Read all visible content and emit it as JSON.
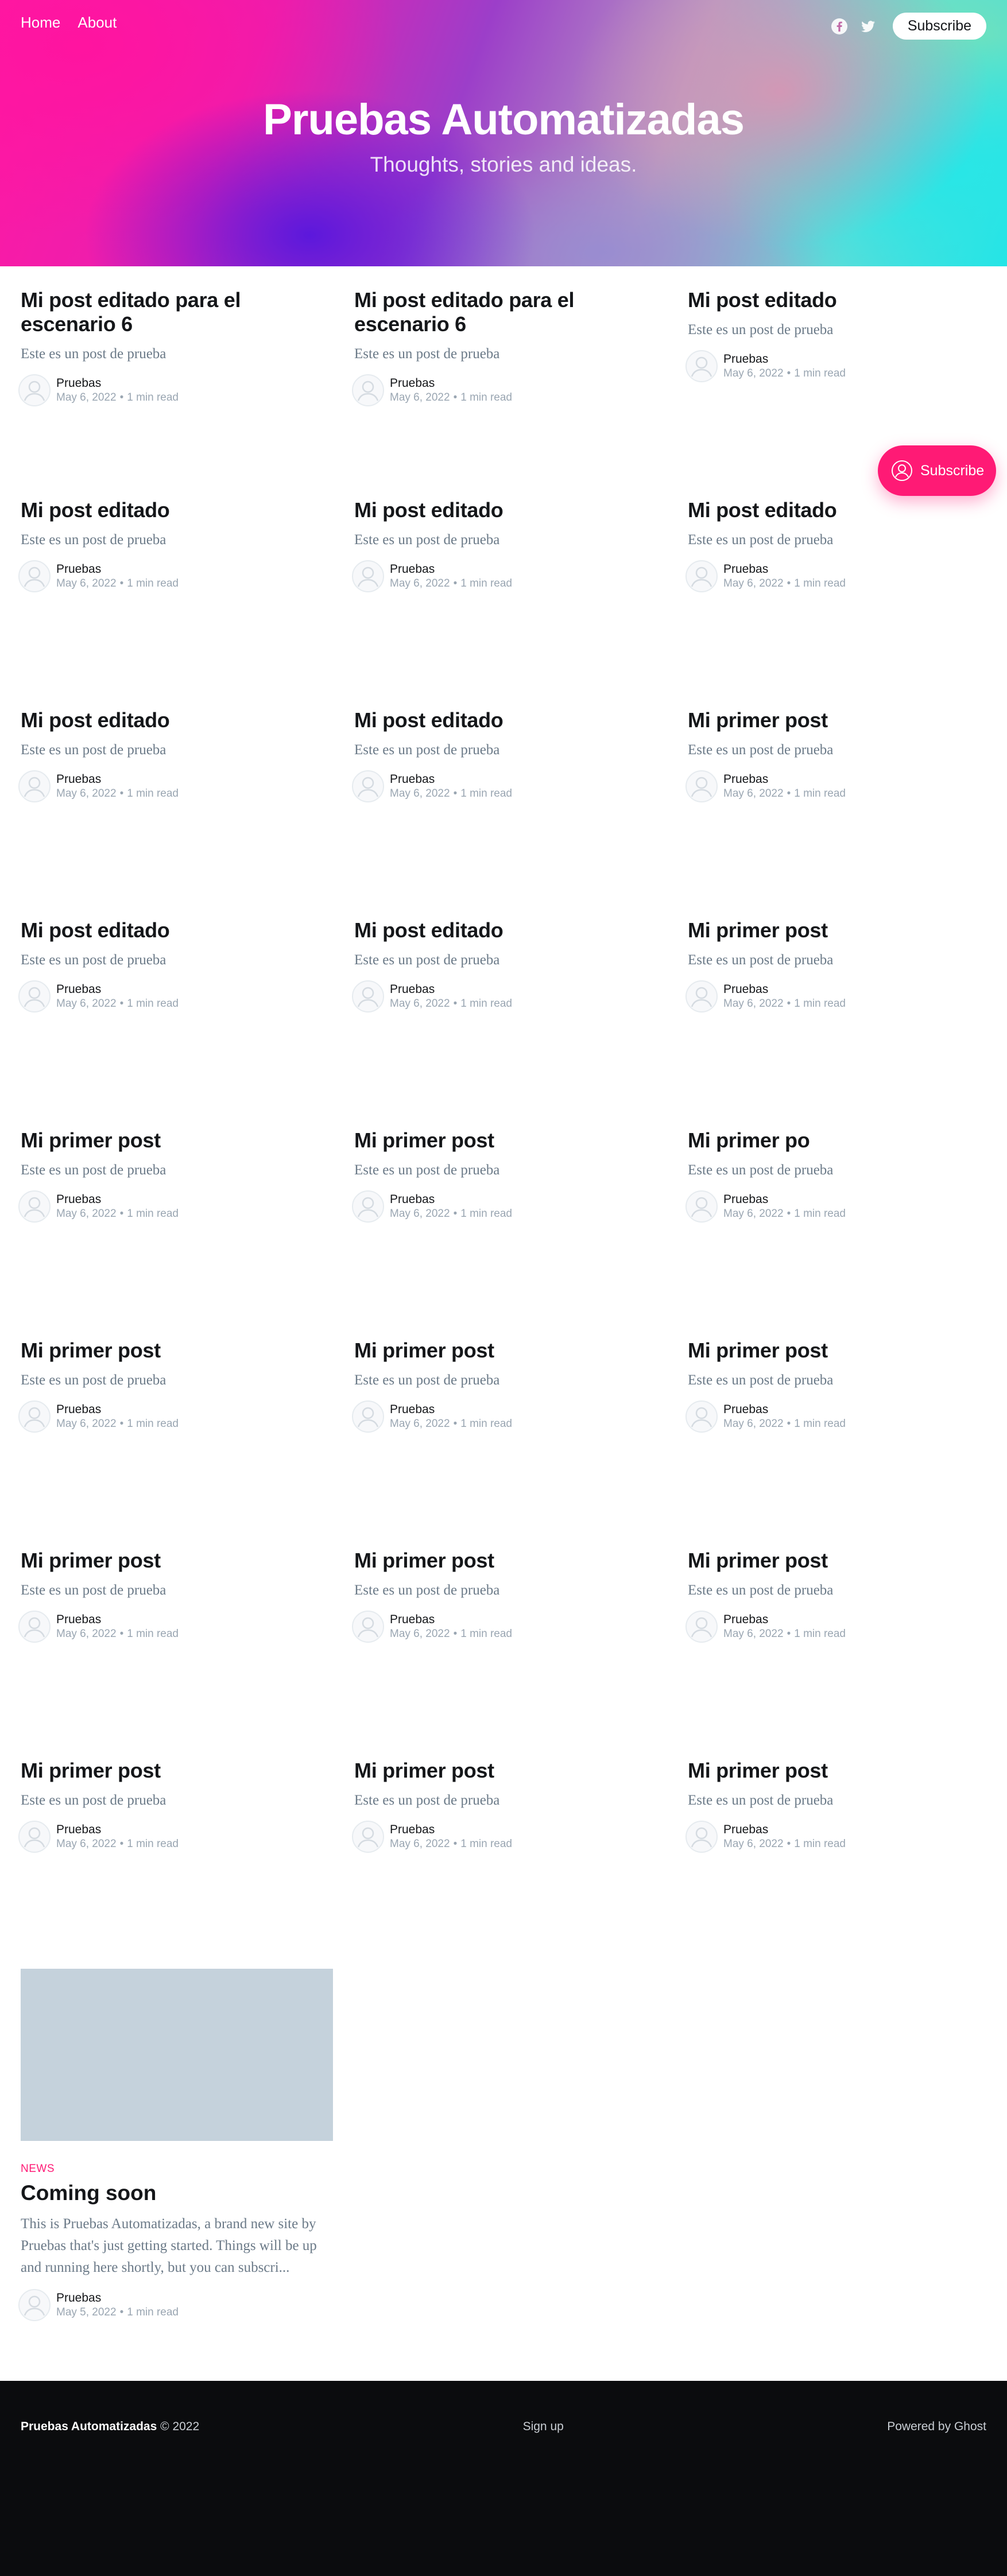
{
  "nav": {
    "items": [
      "Home",
      "About"
    ]
  },
  "header_actions": {
    "facebook_icon": "facebook-icon",
    "twitter_icon": "twitter-icon",
    "subscribe_label": "Subscribe"
  },
  "site": {
    "title": "Pruebas Automatizadas",
    "description": "Thoughts, stories and ideas."
  },
  "posts": [
    [
      {
        "title": "Mi post editado para el escenario 6",
        "excerpt": "Este es un post de prueba",
        "author": "Pruebas",
        "date": "May 6, 2022",
        "read": "1 min read"
      },
      {
        "title": "Mi post editado para el escenario 6",
        "excerpt": "Este es un post de prueba",
        "author": "Pruebas",
        "date": "May 6, 2022",
        "read": "1 min read"
      },
      {
        "title": "Mi post editado",
        "excerpt": "Este es un post de prueba",
        "author": "Pruebas",
        "date": "May 6, 2022",
        "read": "1 min read"
      }
    ],
    [
      {
        "title": "Mi post editado",
        "excerpt": "Este es un post de prueba",
        "author": "Pruebas",
        "date": "May 6, 2022",
        "read": "1 min read"
      },
      {
        "title": "Mi post editado",
        "excerpt": "Este es un post de prueba",
        "author": "Pruebas",
        "date": "May 6, 2022",
        "read": "1 min read"
      },
      {
        "title": "Mi post editado",
        "excerpt": "Este es un post de prueba",
        "author": "Pruebas",
        "date": "May 6, 2022",
        "read": "1 min read"
      }
    ],
    [
      {
        "title": "Mi post editado",
        "excerpt": "Este es un post de prueba",
        "author": "Pruebas",
        "date": "May 6, 2022",
        "read": "1 min read"
      },
      {
        "title": "Mi post editado",
        "excerpt": "Este es un post de prueba",
        "author": "Pruebas",
        "date": "May 6, 2022",
        "read": "1 min read"
      },
      {
        "title": "Mi primer post",
        "excerpt": "Este es un post de prueba",
        "author": "Pruebas",
        "date": "May 6, 2022",
        "read": "1 min read"
      }
    ],
    [
      {
        "title": "Mi post editado",
        "excerpt": "Este es un post de prueba",
        "author": "Pruebas",
        "date": "May 6, 2022",
        "read": "1 min read"
      },
      {
        "title": "Mi post editado",
        "excerpt": "Este es un post de prueba",
        "author": "Pruebas",
        "date": "May 6, 2022",
        "read": "1 min read"
      },
      {
        "title": "Mi primer post",
        "excerpt": "Este es un post de prueba",
        "author": "Pruebas",
        "date": "May 6, 2022",
        "read": "1 min read"
      }
    ],
    [
      {
        "title": "Mi primer post",
        "excerpt": "Este es un post de prueba",
        "author": "Pruebas",
        "date": "May 6, 2022",
        "read": "1 min read"
      },
      {
        "title": "Mi primer post",
        "excerpt": "Este es un post de prueba",
        "author": "Pruebas",
        "date": "May 6, 2022",
        "read": "1 min read"
      },
      {
        "title": "Mi primer po",
        "excerpt": "Este es un post de prueba",
        "author": "Pruebas",
        "date": "May 6, 2022",
        "read": "1 min read"
      }
    ],
    [
      {
        "title": "Mi primer post",
        "excerpt": "Este es un post de prueba",
        "author": "Pruebas",
        "date": "May 6, 2022",
        "read": "1 min read"
      },
      {
        "title": "Mi primer post",
        "excerpt": "Este es un post de prueba",
        "author": "Pruebas",
        "date": "May 6, 2022",
        "read": "1 min read"
      },
      {
        "title": "Mi primer post",
        "excerpt": "Este es un post de prueba",
        "author": "Pruebas",
        "date": "May 6, 2022",
        "read": "1 min read"
      }
    ],
    [
      {
        "title": "Mi primer post",
        "excerpt": "Este es un post de prueba",
        "author": "Pruebas",
        "date": "May 6, 2022",
        "read": "1 min read"
      },
      {
        "title": "Mi primer post",
        "excerpt": "Este es un post de prueba",
        "author": "Pruebas",
        "date": "May 6, 2022",
        "read": "1 min read"
      },
      {
        "title": "Mi primer post",
        "excerpt": "Este es un post de prueba",
        "author": "Pruebas",
        "date": "May 6, 2022",
        "read": "1 min read"
      }
    ],
    [
      {
        "title": "Mi primer post",
        "excerpt": "Este es un post de prueba",
        "author": "Pruebas",
        "date": "May 6, 2022",
        "read": "1 min read"
      },
      {
        "title": "Mi primer post",
        "excerpt": "Este es un post de prueba",
        "author": "Pruebas",
        "date": "May 6, 2022",
        "read": "1 min read"
      },
      {
        "title": "Mi primer post",
        "excerpt": "Este es un post de prueba",
        "author": "Pruebas",
        "date": "May 6, 2022",
        "read": "1 min read"
      }
    ]
  ],
  "featured": {
    "tag": "News",
    "title": "Coming soon",
    "excerpt": "This is Pruebas Automatizadas, a brand new site by Pruebas that's just getting started. Things will be up and running here shortly, but you can subscri...",
    "author": "Pruebas",
    "date": "May 5, 2022",
    "read": "1 min read"
  },
  "portal": {
    "label": "Subscribe",
    "icon": "user-icon",
    "color": "#ff1a75"
  },
  "footer": {
    "site_name": "Pruebas Automatizadas",
    "copyright": "© 2022",
    "signup": "Sign up",
    "powered": "Powered by Ghost"
  },
  "colors": {
    "accent": "#ff1a75",
    "footer_bg": "#0b0c0e",
    "muted": "#6b7a88"
  }
}
